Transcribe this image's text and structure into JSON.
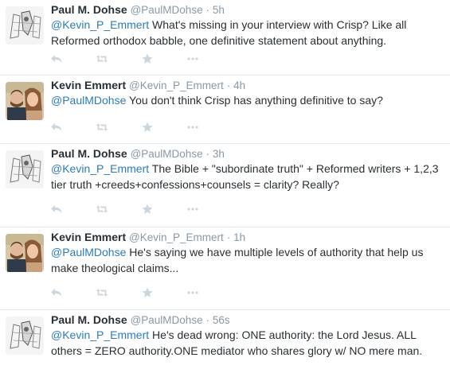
{
  "colors": {
    "mention": "#2b7bb9",
    "meta": "#8899a6",
    "action_icon": "#ccd6dd"
  },
  "tweets": [
    {
      "name": "Paul M. Dohse",
      "handle": "@PaulMDohse",
      "time": "5h",
      "mention": "@Kevin_P_Emmert",
      "body": " What's missing in your interview with Crisp? Like all Reformed orthodox babble, one definitive statement about anything.",
      "avatar": "sketch"
    },
    {
      "name": "Kevin Emmert",
      "handle": "@Kevin_P_Emmert",
      "time": "4h",
      "mention": "@PaulMDohse",
      "body": " You don't think Crisp has anything definitive to say?",
      "avatar": "photo"
    },
    {
      "name": "Paul M. Dohse",
      "handle": "@PaulMDohse",
      "time": "3h",
      "mention": "@Kevin_P_Emmert",
      "body": " The Bible + \"subordinate truth\" + Reformed writers + 1,2,3 tier truth +creeds+confessions+counsels = clarity? Really?",
      "avatar": "sketch"
    },
    {
      "name": "Kevin Emmert",
      "handle": "@Kevin_P_Emmert",
      "time": "1h",
      "mention": "@PaulMDohse",
      "body": " He's saying we have multiple levels of authority that help us make theological claims...",
      "avatar": "photo"
    },
    {
      "name": "Paul M. Dohse",
      "handle": "@PaulMDohse",
      "time": "56s",
      "mention": "@Kevin_P_Emmert",
      "body": " He's dead wrong: ONE authority: the Lord Jesus. ALL others = ZERO authority.ONE mediator who shares glory w/ NO mere man.",
      "avatar": "sketch"
    }
  ],
  "action_icons": [
    "reply-icon",
    "retweet-icon",
    "favorite-icon",
    "more-icon"
  ],
  "separator": "·"
}
